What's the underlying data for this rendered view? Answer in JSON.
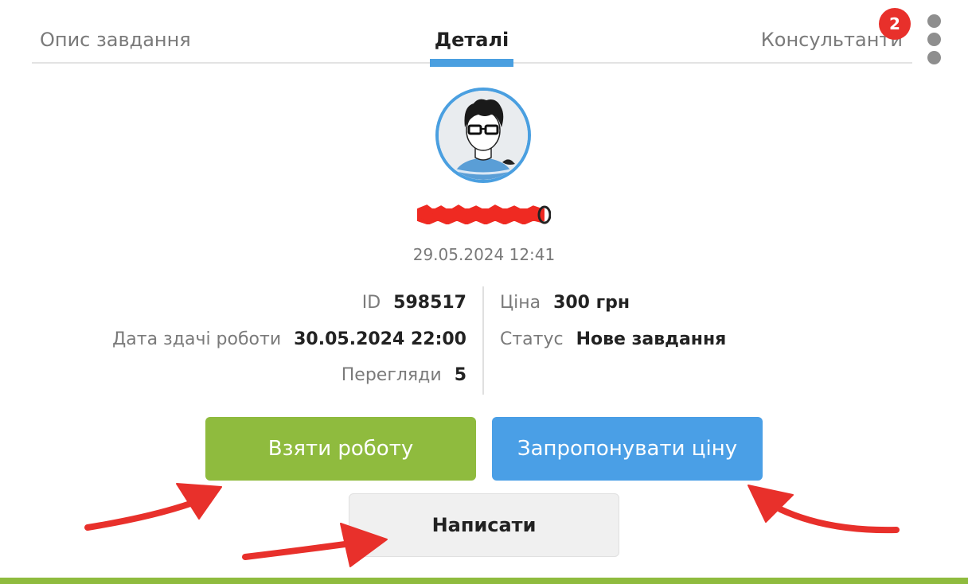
{
  "tabs": {
    "description": "Опис завдання",
    "details": "Деталі",
    "consultants": "Консультанти",
    "consultants_badge": "2"
  },
  "user": {
    "date": "29.05.2024 12:41"
  },
  "details": {
    "id_label": "ID",
    "id_value": "598517",
    "deadline_label": "Дата здачі роботи",
    "deadline_value": "30.05.2024 22:00",
    "views_label": "Перегляди",
    "views_value": "5",
    "price_label": "Ціна",
    "price_value": "300 грн",
    "status_label": "Статус",
    "status_value": "Нове завдання"
  },
  "actions": {
    "take_work": "Взяти роботу",
    "offer_price": "Запропонувати ціну",
    "write": "Написати"
  },
  "colors": {
    "accent_blue": "#4a9fe0",
    "green": "#8fbb3e",
    "badge_red": "#e8302b",
    "annotation_red": "#e8302b"
  }
}
